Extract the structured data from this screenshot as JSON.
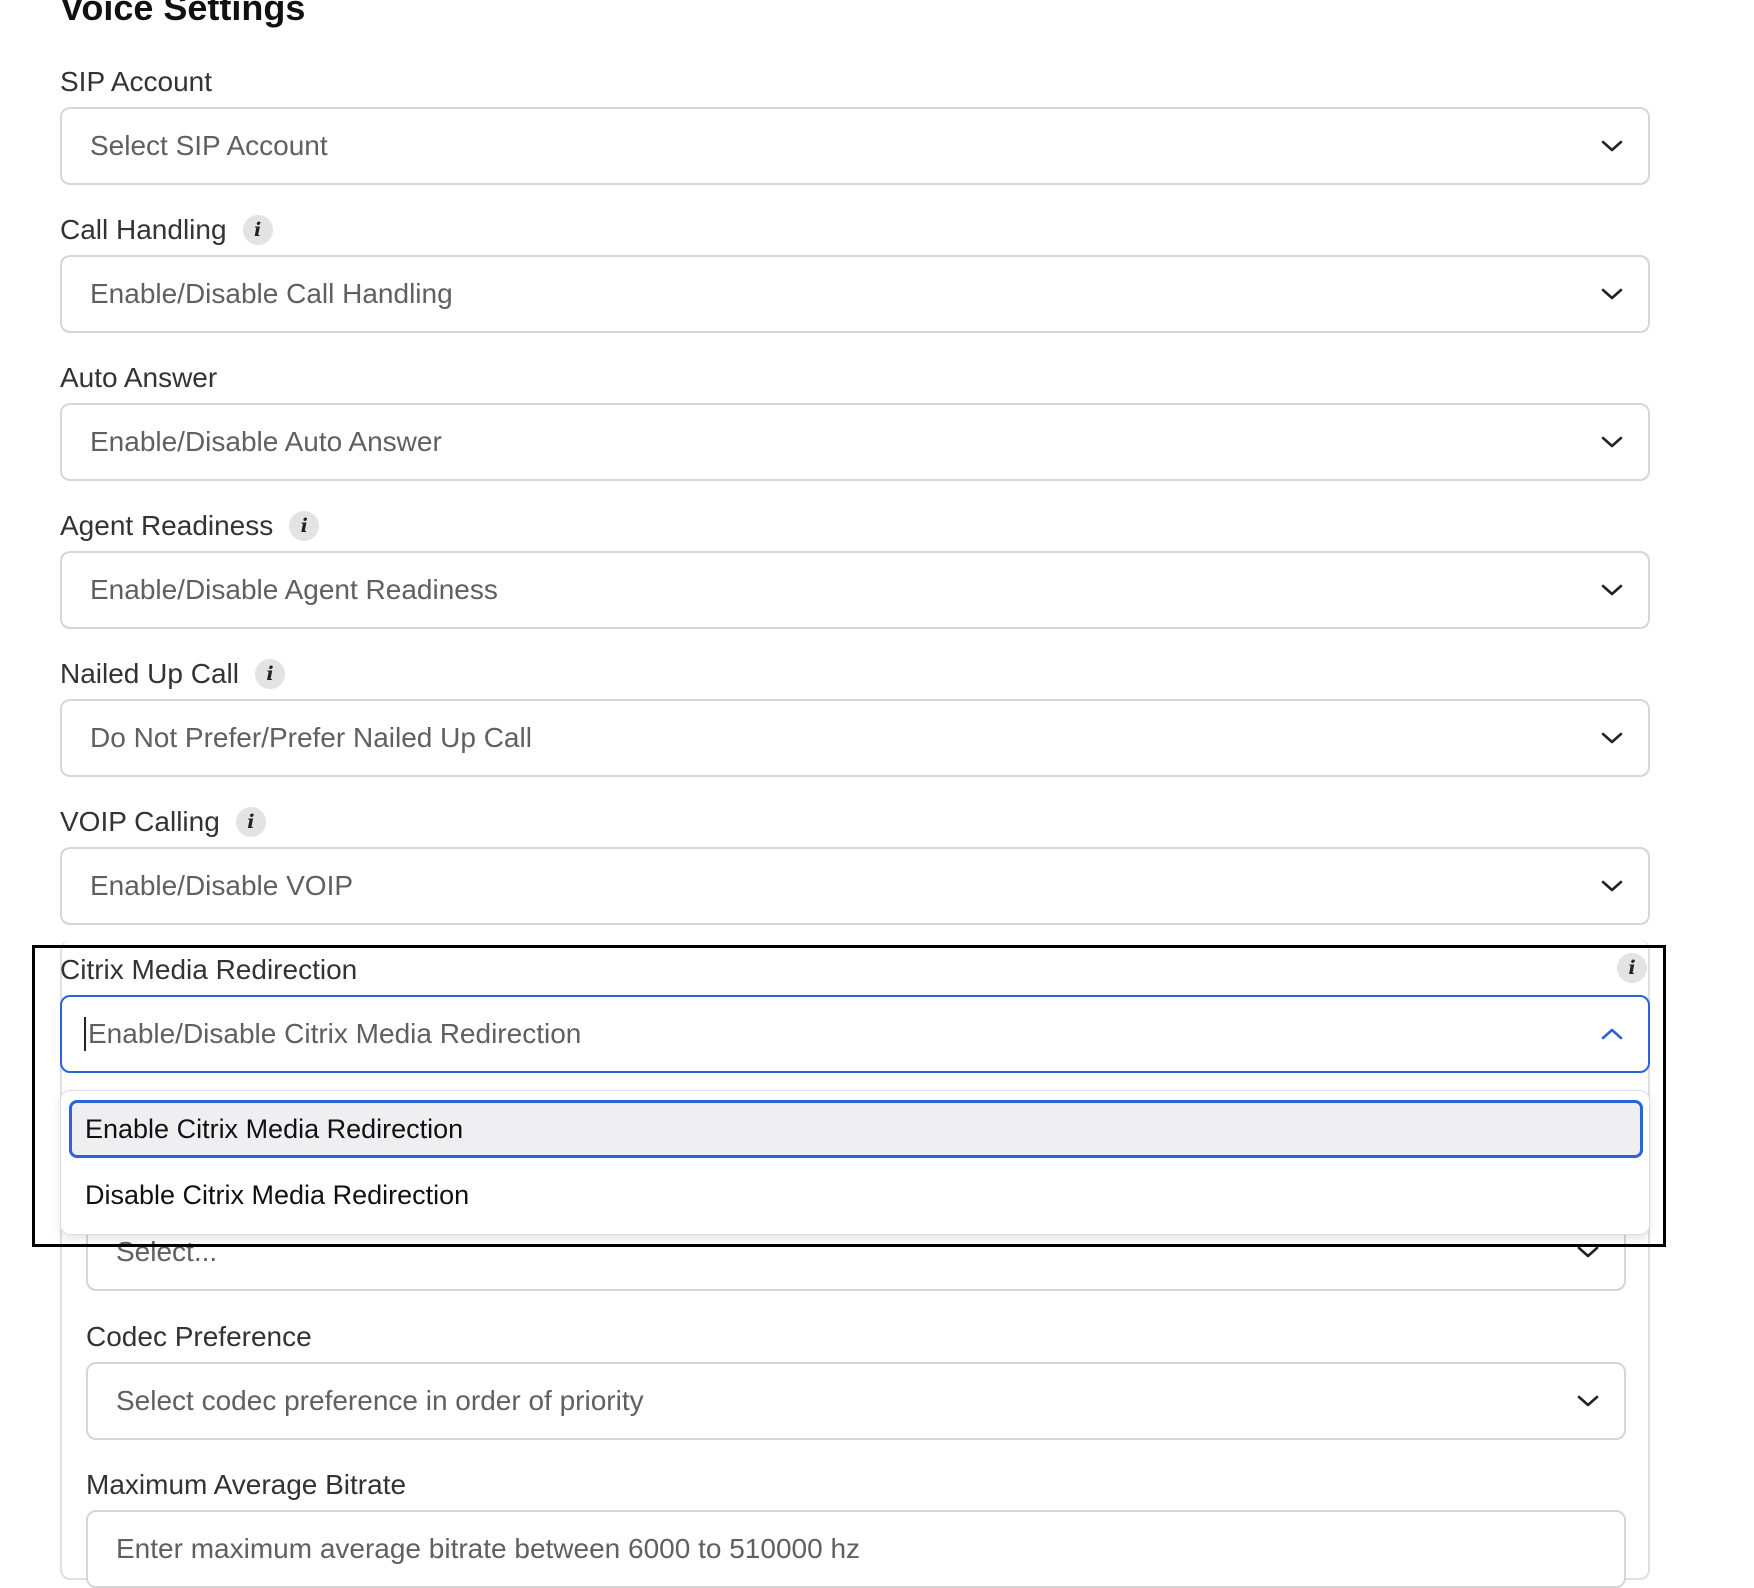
{
  "page": {
    "title": "Voice Settings"
  },
  "fields": {
    "sip_account": {
      "label": "SIP Account",
      "placeholder": "Select SIP Account"
    },
    "call_handling": {
      "label": "Call Handling",
      "placeholder": "Enable/Disable Call Handling"
    },
    "auto_answer": {
      "label": "Auto Answer",
      "placeholder": "Enable/Disable Auto Answer"
    },
    "agent_readiness": {
      "label": "Agent Readiness",
      "placeholder": "Enable/Disable Agent Readiness"
    },
    "nailed_up_call": {
      "label": "Nailed Up Call",
      "placeholder": "Do Not Prefer/Prefer Nailed Up Call"
    },
    "voip_calling": {
      "label": "VOIP Calling",
      "placeholder": "Enable/Disable VOIP"
    },
    "citrix_media_redirection": {
      "label": "Citrix Media Redirection",
      "placeholder": "Enable/Disable Citrix Media Redirection",
      "state": "open",
      "options": [
        "Enable Citrix Media Redirection",
        "Disable Citrix Media Redirection"
      ],
      "highlighted_option": "Enable Citrix Media Redirection"
    },
    "hidden_select": {
      "placeholder": "Select..."
    },
    "codec_preference": {
      "label": "Codec Preference",
      "placeholder": "Select codec preference in order of priority"
    },
    "max_average_bitrate": {
      "label": "Maximum Average Bitrate",
      "placeholder": "Enter maximum average bitrate between 6000 to 510000 hz"
    }
  },
  "icons": {
    "info": "i",
    "chevron_down": "chevron-down-icon",
    "chevron_up": "chevron-up-icon"
  },
  "colors": {
    "focus_border": "#2a64d8",
    "option_highlight_bg": "#efeff1",
    "annotation_frame": "#000000"
  }
}
